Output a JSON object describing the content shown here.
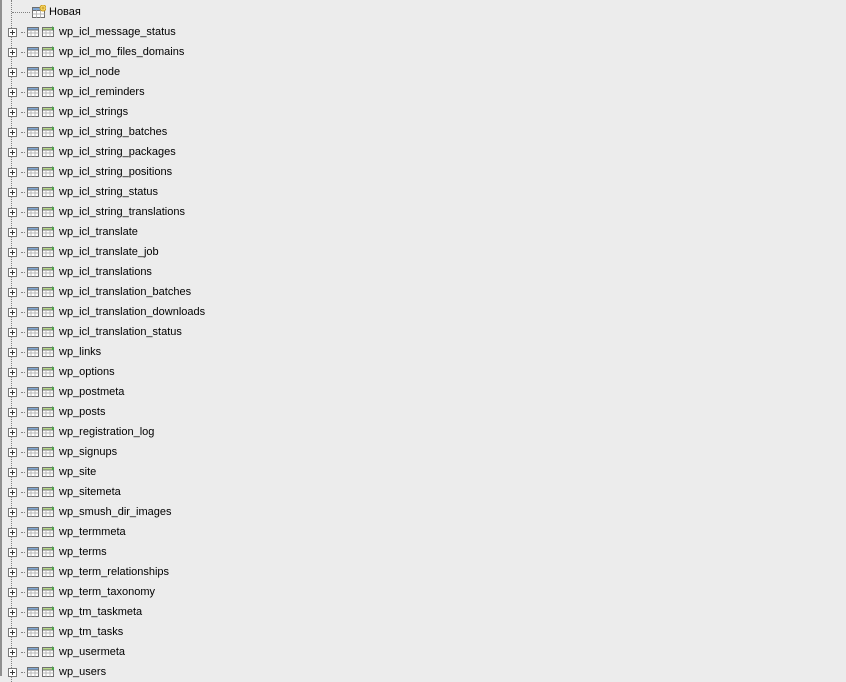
{
  "first_item": {
    "label": "Новая"
  },
  "items": [
    {
      "label": "wp_icl_message_status"
    },
    {
      "label": "wp_icl_mo_files_domains"
    },
    {
      "label": "wp_icl_node"
    },
    {
      "label": "wp_icl_reminders"
    },
    {
      "label": "wp_icl_strings"
    },
    {
      "label": "wp_icl_string_batches"
    },
    {
      "label": "wp_icl_string_packages"
    },
    {
      "label": "wp_icl_string_positions"
    },
    {
      "label": "wp_icl_string_status"
    },
    {
      "label": "wp_icl_string_translations"
    },
    {
      "label": "wp_icl_translate"
    },
    {
      "label": "wp_icl_translate_job"
    },
    {
      "label": "wp_icl_translations"
    },
    {
      "label": "wp_icl_translation_batches"
    },
    {
      "label": "wp_icl_translation_downloads"
    },
    {
      "label": "wp_icl_translation_status"
    },
    {
      "label": "wp_links"
    },
    {
      "label": "wp_options"
    },
    {
      "label": "wp_postmeta"
    },
    {
      "label": "wp_posts"
    },
    {
      "label": "wp_registration_log"
    },
    {
      "label": "wp_signups"
    },
    {
      "label": "wp_site"
    },
    {
      "label": "wp_sitemeta"
    },
    {
      "label": "wp_smush_dir_images"
    },
    {
      "label": "wp_termmeta"
    },
    {
      "label": "wp_terms"
    },
    {
      "label": "wp_term_relationships"
    },
    {
      "label": "wp_term_taxonomy"
    },
    {
      "label": "wp_tm_taskmeta"
    },
    {
      "label": "wp_tm_tasks"
    },
    {
      "label": "wp_usermeta"
    },
    {
      "label": "wp_users"
    }
  ]
}
